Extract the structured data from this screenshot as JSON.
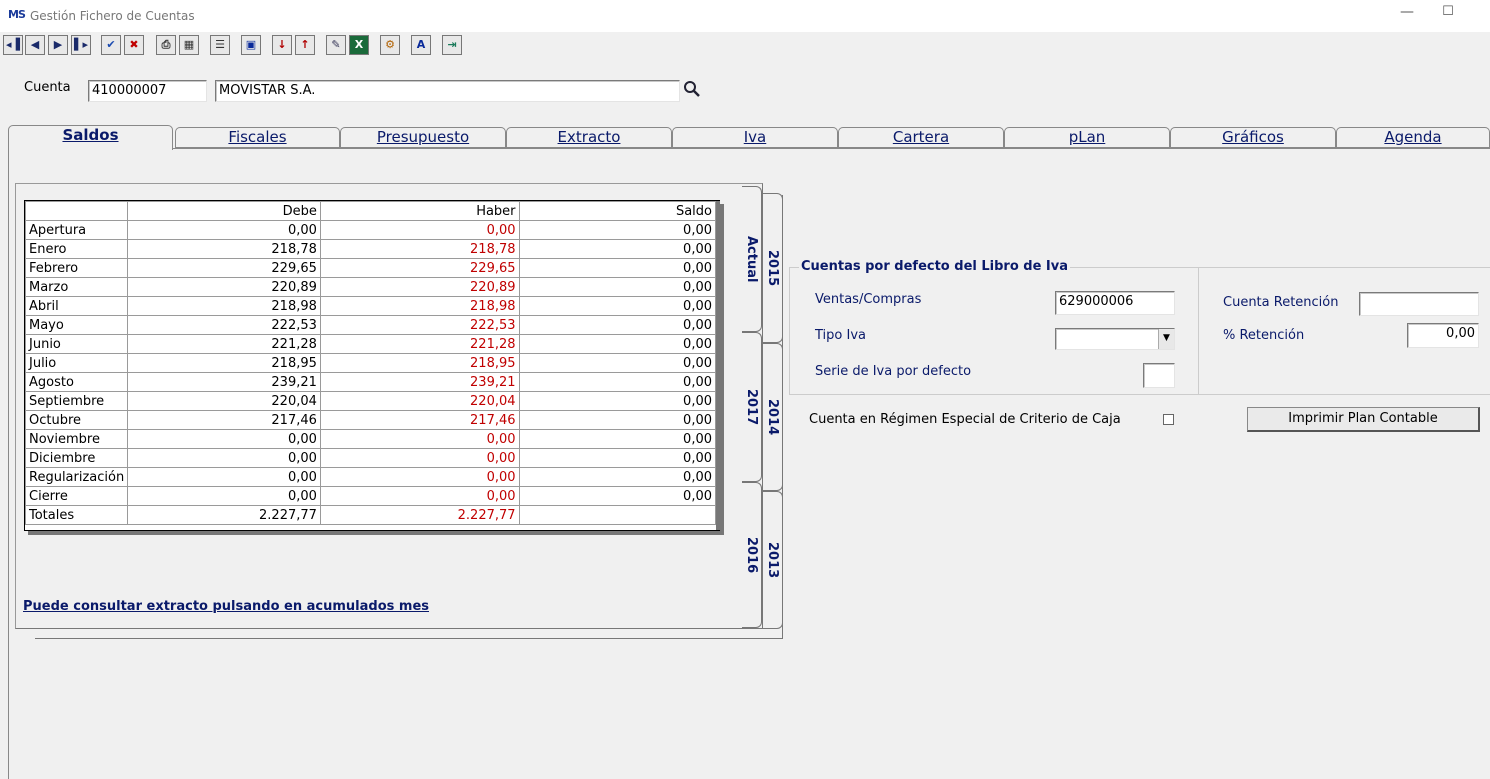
{
  "window": {
    "app_icon": "MS",
    "title": "Gestión Fichero de Cuentas",
    "minimize_glyph": "—",
    "maximize_glyph": "☐"
  },
  "toolbar": {
    "buttons": [
      {
        "name": "first-record-button",
        "glyph": "◂▐"
      },
      {
        "name": "prev-record-button",
        "glyph": "◀"
      },
      {
        "name": "next-record-button",
        "glyph": "▶"
      },
      {
        "name": "last-record-button",
        "glyph": "▌▸"
      },
      {
        "name": "accept-button",
        "glyph": "✔"
      },
      {
        "name": "cancel-button",
        "glyph": "✖"
      },
      {
        "name": "print-button",
        "glyph": "⎙"
      },
      {
        "name": "calculator-button",
        "glyph": "▦"
      },
      {
        "name": "list-button",
        "glyph": "☰"
      },
      {
        "name": "screen-button",
        "glyph": "▣"
      },
      {
        "name": "sort-asc-button",
        "glyph": "↓"
      },
      {
        "name": "sort-desc-button",
        "glyph": "↑"
      },
      {
        "name": "notes-button",
        "glyph": "✎"
      },
      {
        "name": "excel-button",
        "glyph": "X"
      },
      {
        "name": "tools-button",
        "glyph": "⚙"
      },
      {
        "name": "word-button",
        "glyph": "A"
      },
      {
        "name": "exit-button",
        "glyph": "⇥"
      }
    ]
  },
  "account": {
    "label": "Cuenta",
    "code": "410000007",
    "name": "MOVISTAR S.A."
  },
  "tabs": [
    {
      "label": "Saldos",
      "active": true
    },
    {
      "label": "Fiscales"
    },
    {
      "label": "Presupuesto"
    },
    {
      "label": "Extracto"
    },
    {
      "label": "Iva"
    },
    {
      "label": "Cartera"
    },
    {
      "label": "pLan"
    },
    {
      "label": "Gráficos"
    },
    {
      "label": "Agenda"
    }
  ],
  "year_tabs": {
    "actual": "Actual",
    "y2015": "2015",
    "y2017": "2017",
    "y2014": "2014",
    "y2016": "2016",
    "y2013": "2013"
  },
  "grid": {
    "headers": [
      "",
      "Debe",
      "Haber",
      "Saldo"
    ],
    "rows": [
      [
        "Apertura",
        "0,00",
        "0,00",
        "0,00"
      ],
      [
        "Enero",
        "218,78",
        "218,78",
        "0,00"
      ],
      [
        "Febrero",
        "229,65",
        "229,65",
        "0,00"
      ],
      [
        "Marzo",
        "220,89",
        "220,89",
        "0,00"
      ],
      [
        "Abril",
        "218,98",
        "218,98",
        "0,00"
      ],
      [
        "Mayo",
        "222,53",
        "222,53",
        "0,00"
      ],
      [
        "Junio",
        "221,28",
        "221,28",
        "0,00"
      ],
      [
        "Julio",
        "218,95",
        "218,95",
        "0,00"
      ],
      [
        "Agosto",
        "239,21",
        "239,21",
        "0,00"
      ],
      [
        "Septiembre",
        "220,04",
        "220,04",
        "0,00"
      ],
      [
        "Octubre",
        "217,46",
        "217,46",
        "0,00"
      ],
      [
        "Noviembre",
        "0,00",
        "0,00",
        "0,00"
      ],
      [
        "Diciembre",
        "0,00",
        "0,00",
        "0,00"
      ],
      [
        "Regularización",
        "0,00",
        "0,00",
        "0,00"
      ],
      [
        "Cierre",
        "0,00",
        "0,00",
        "0,00"
      ],
      [
        "Totales",
        "2.227,77",
        "2.227,77",
        ""
      ]
    ]
  },
  "hint": "Puede consultar extracto pulsando en acumulados mes",
  "iva_group": {
    "title": "Cuentas por defecto del Libro de Iva",
    "ventas_label": "Ventas/Compras",
    "ventas_value": "629000006",
    "tipo_label": "Tipo Iva",
    "tipo_value": "",
    "serie_label": "Serie de Iva por defecto",
    "serie_value": "",
    "ret_label": "Cuenta Retención",
    "ret_value": "",
    "pct_label": "% Retención",
    "pct_value": "0,00"
  },
  "caja_label": "Cuenta en Régimen Especial de Criterio de Caja",
  "print_button": "Imprimir Plan Contable",
  "colors": {
    "accent": "#0a1a6a",
    "negative": "#c00000"
  }
}
